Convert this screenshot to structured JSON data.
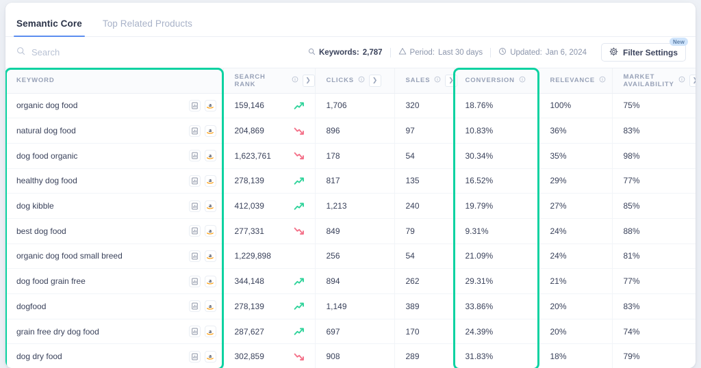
{
  "tabs": [
    {
      "label": "Semantic Core",
      "active": true
    },
    {
      "label": "Top Related Products",
      "active": false
    }
  ],
  "search": {
    "placeholder": "Search",
    "value": "",
    "icon": "search-icon"
  },
  "meta": {
    "keywords_label": "Keywords:",
    "keywords_value": "2,787",
    "period_label": "Period:",
    "period_value": "Last 30 days",
    "updated_label": "Updated:",
    "updated_value": "Jan 6, 2024",
    "filter_button": "Filter Settings",
    "new_badge": "New"
  },
  "columns": [
    {
      "label": "KEYWORD",
      "info": false,
      "chevron": false
    },
    {
      "label": "SEARCH RANK",
      "info": true,
      "chevron": true
    },
    {
      "label": "CLICKS",
      "info": true,
      "chevron": true
    },
    {
      "label": "SALES",
      "info": true,
      "chevron": true
    },
    {
      "label": "CONVERSION",
      "info": true,
      "chevron": false
    },
    {
      "label": "RELEVANCE",
      "info": true,
      "chevron": false
    },
    {
      "label": "MARKET AVAILABILITY",
      "info": true,
      "chevron": true
    }
  ],
  "rows": [
    {
      "keyword": "organic dog food",
      "search_rank": "159,146",
      "trend": "up",
      "clicks": "1,706",
      "sales": "320",
      "conversion": "18.76%",
      "relevance": "100%",
      "market_availability": "75%"
    },
    {
      "keyword": "natural dog food",
      "search_rank": "204,869",
      "trend": "down",
      "clicks": "896",
      "sales": "97",
      "conversion": "10.83%",
      "relevance": "36%",
      "market_availability": "83%"
    },
    {
      "keyword": "dog food organic",
      "search_rank": "1,623,761",
      "trend": "down",
      "clicks": "178",
      "sales": "54",
      "conversion": "30.34%",
      "relevance": "35%",
      "market_availability": "98%"
    },
    {
      "keyword": "healthy dog food",
      "search_rank": "278,139",
      "trend": "up",
      "clicks": "817",
      "sales": "135",
      "conversion": "16.52%",
      "relevance": "29%",
      "market_availability": "77%"
    },
    {
      "keyword": "dog kibble",
      "search_rank": "412,039",
      "trend": "up",
      "clicks": "1,213",
      "sales": "240",
      "conversion": "19.79%",
      "relevance": "27%",
      "market_availability": "85%"
    },
    {
      "keyword": "best dog food",
      "search_rank": "277,331",
      "trend": "down",
      "clicks": "849",
      "sales": "79",
      "conversion": "9.31%",
      "relevance": "24%",
      "market_availability": "88%"
    },
    {
      "keyword": "organic dog food small breed",
      "search_rank": "1,229,898",
      "trend": "none",
      "clicks": "256",
      "sales": "54",
      "conversion": "21.09%",
      "relevance": "24%",
      "market_availability": "81%"
    },
    {
      "keyword": "dog food grain free",
      "search_rank": "344,148",
      "trend": "up",
      "clicks": "894",
      "sales": "262",
      "conversion": "29.31%",
      "relevance": "21%",
      "market_availability": "77%"
    },
    {
      "keyword": "dogfood",
      "search_rank": "278,139",
      "trend": "up",
      "clicks": "1,149",
      "sales": "389",
      "conversion": "33.86%",
      "relevance": "20%",
      "market_availability": "83%"
    },
    {
      "keyword": "grain free dry dog food",
      "search_rank": "287,627",
      "trend": "up",
      "clicks": "697",
      "sales": "170",
      "conversion": "24.39%",
      "relevance": "20%",
      "market_availability": "74%"
    },
    {
      "keyword": "dog dry food",
      "search_rank": "302,859",
      "trend": "down",
      "clicks": "908",
      "sales": "289",
      "conversion": "31.83%",
      "relevance": "18%",
      "market_availability": "79%"
    }
  ],
  "row_icons": {
    "report": "report-icon",
    "marketplace": "amazon-icon"
  },
  "highlights": [
    {
      "name": "keyword-column-highlight",
      "column": "KEYWORD"
    },
    {
      "name": "conversion-column-highlight",
      "column": "CONVERSION"
    }
  ],
  "colors": {
    "highlight": "#0ad2a1",
    "trend_up": "#2fd39a",
    "trend_down": "#f4728a",
    "tab_active_underline": "#5b8def",
    "badge_bg": "#cfe4fb",
    "amazon_orange": "#ff9900"
  }
}
